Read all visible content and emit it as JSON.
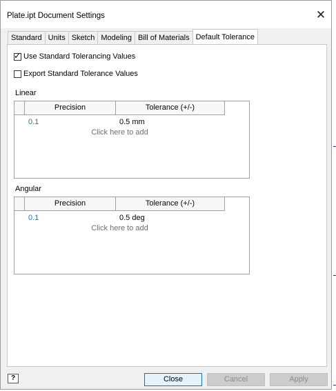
{
  "window": {
    "title": "Plate.ipt Document Settings",
    "close_glyph": "✕"
  },
  "tabs": [
    {
      "label": "Standard",
      "active": false
    },
    {
      "label": "Units",
      "active": false
    },
    {
      "label": "Sketch",
      "active": false
    },
    {
      "label": "Modeling",
      "active": false
    },
    {
      "label": "Bill of Materials",
      "active": false
    },
    {
      "label": "Default Tolerance",
      "active": true
    }
  ],
  "options": {
    "use_standard": {
      "label": "Use Standard Tolerancing Values",
      "checked": true
    },
    "export_standard": {
      "label": "Export Standard Tolerance Values",
      "checked": false
    }
  },
  "linear": {
    "label": "Linear",
    "columns": [
      "Precision",
      "Tolerance (+/-)"
    ],
    "rows": [
      {
        "precision": "0.1",
        "tolerance": "0.5 mm"
      }
    ],
    "add_hint": "Click here to add"
  },
  "angular": {
    "label": "Angular",
    "columns": [
      "Precision",
      "Tolerance (+/-)"
    ],
    "rows": [
      {
        "precision": "0.1",
        "tolerance": "0.5 deg"
      }
    ],
    "add_hint": "Click here to add"
  },
  "buttons": {
    "help_glyph": "?",
    "close": "Close",
    "cancel": "Cancel",
    "apply": "Apply"
  },
  "colors": {
    "precision_link": "#2c6fb6",
    "primary_border": "#0078d7"
  }
}
